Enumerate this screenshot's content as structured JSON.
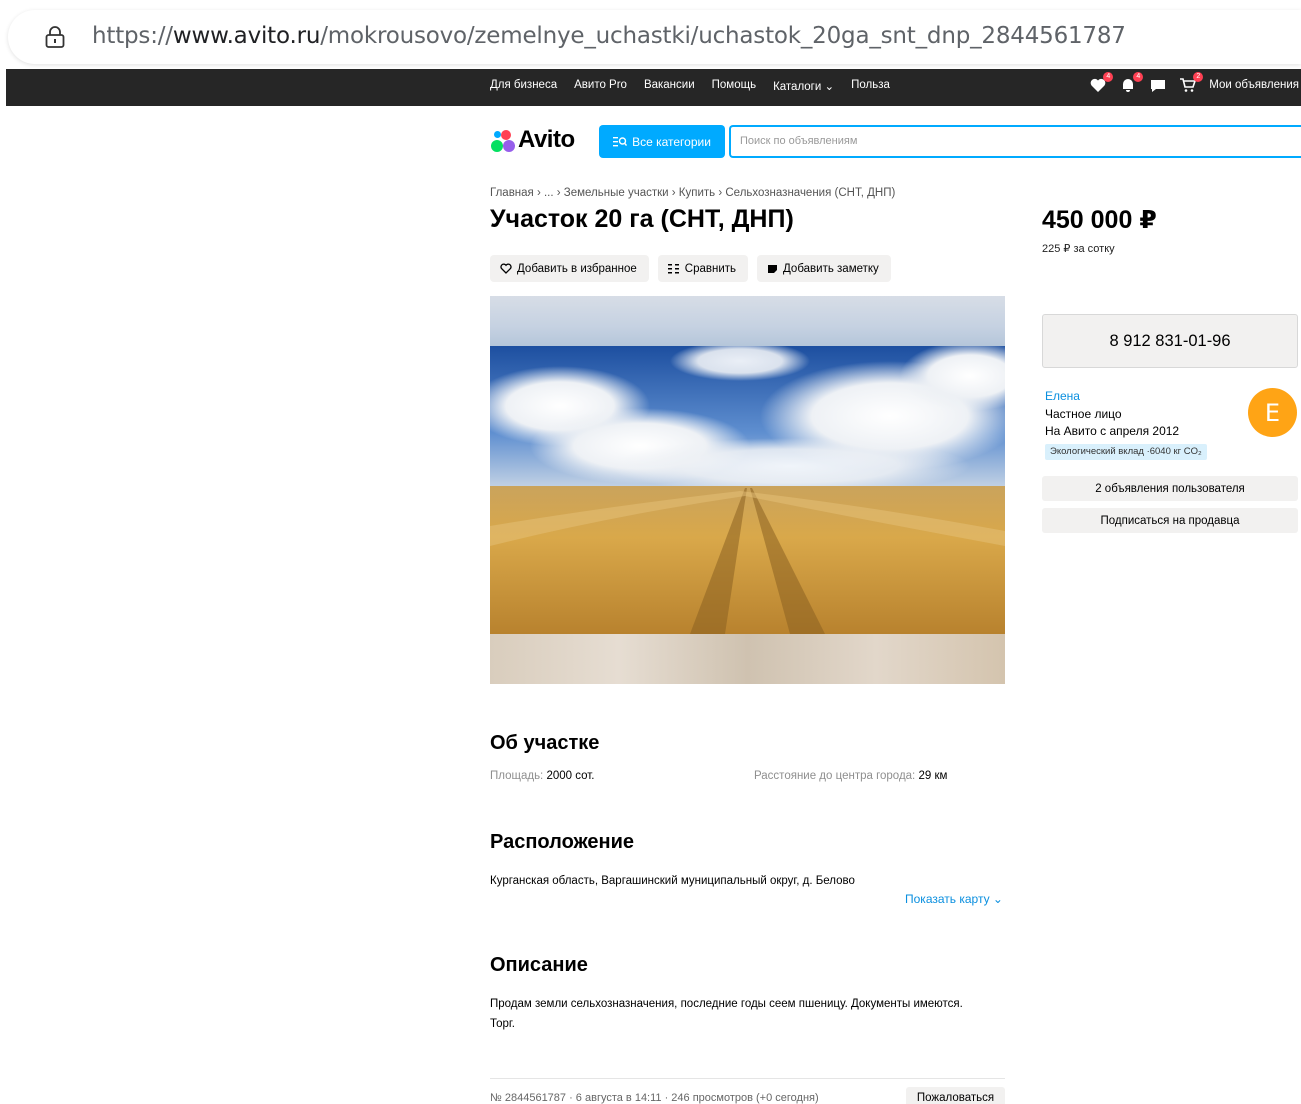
{
  "browser": {
    "url_prefix": "https://",
    "url_host": "www.avito.ru",
    "url_path": "/mokrousovo/zemelnye_uchastki/uchastok_20ga_snt_dnp_2844561787"
  },
  "topbar": {
    "nav": [
      "Для бизнеса",
      "Авито Pro",
      "Вакансии",
      "Помощь",
      "Каталоги ⌄",
      "Польза"
    ],
    "favorites_badge": "4",
    "notifications_badge": "4",
    "cart_badge": "2",
    "my_ads_label": "Мои объявления"
  },
  "header": {
    "logo_text": "Avito",
    "categories_label": "Все категории",
    "search_placeholder": "Поиск по объявлениям"
  },
  "breadcrumb": "Главная  ›  ...  ›  Земельные участки  ›  Купить  ›  Сельхозназначения (СНТ, ДНП)",
  "listing": {
    "title": "Участок 20 га (СНТ, ДНП)",
    "actions": {
      "favorite": "Добавить в избранное",
      "compare": "Сравнить",
      "note": "Добавить заметку"
    },
    "price": "450 000 ₽",
    "price_per": "225 ₽ за сотку",
    "phone": "8 912 831-01-96"
  },
  "seller": {
    "name": "Елена",
    "type": "Частное лицо",
    "since": "На Авито с апреля 2012",
    "eco": "Экологический вклад ·6040 кг CO₂",
    "avatar_letter": "E",
    "ads_button": "2 объявления пользователя",
    "subscribe_button": "Подписаться на продавца"
  },
  "about": {
    "heading": "Об участке",
    "area_key": "Площадь:",
    "area_value": "2000 сот.",
    "distance_key": "Расстояние до центра города:",
    "distance_value": "29 км"
  },
  "location": {
    "heading": "Расположение",
    "address": "Курганская область, Варгашинский муниципальный округ, д. Белово",
    "map_link": "Показать карту ⌄"
  },
  "description": {
    "heading": "Описание",
    "text": "Продам земли сельхозназначения, последние годы сеем пшеницу. Документы имеются. Торг."
  },
  "footer": {
    "meta": "№ 2844561787 · 6 августа в 14:11 · 246 просмотров (+0 сегодня)",
    "report": "Пожаловаться"
  },
  "colors": {
    "accent": "#00aaff",
    "link": "#0a8fdf",
    "avatar": "#ffa415",
    "topbar": "#262626"
  }
}
